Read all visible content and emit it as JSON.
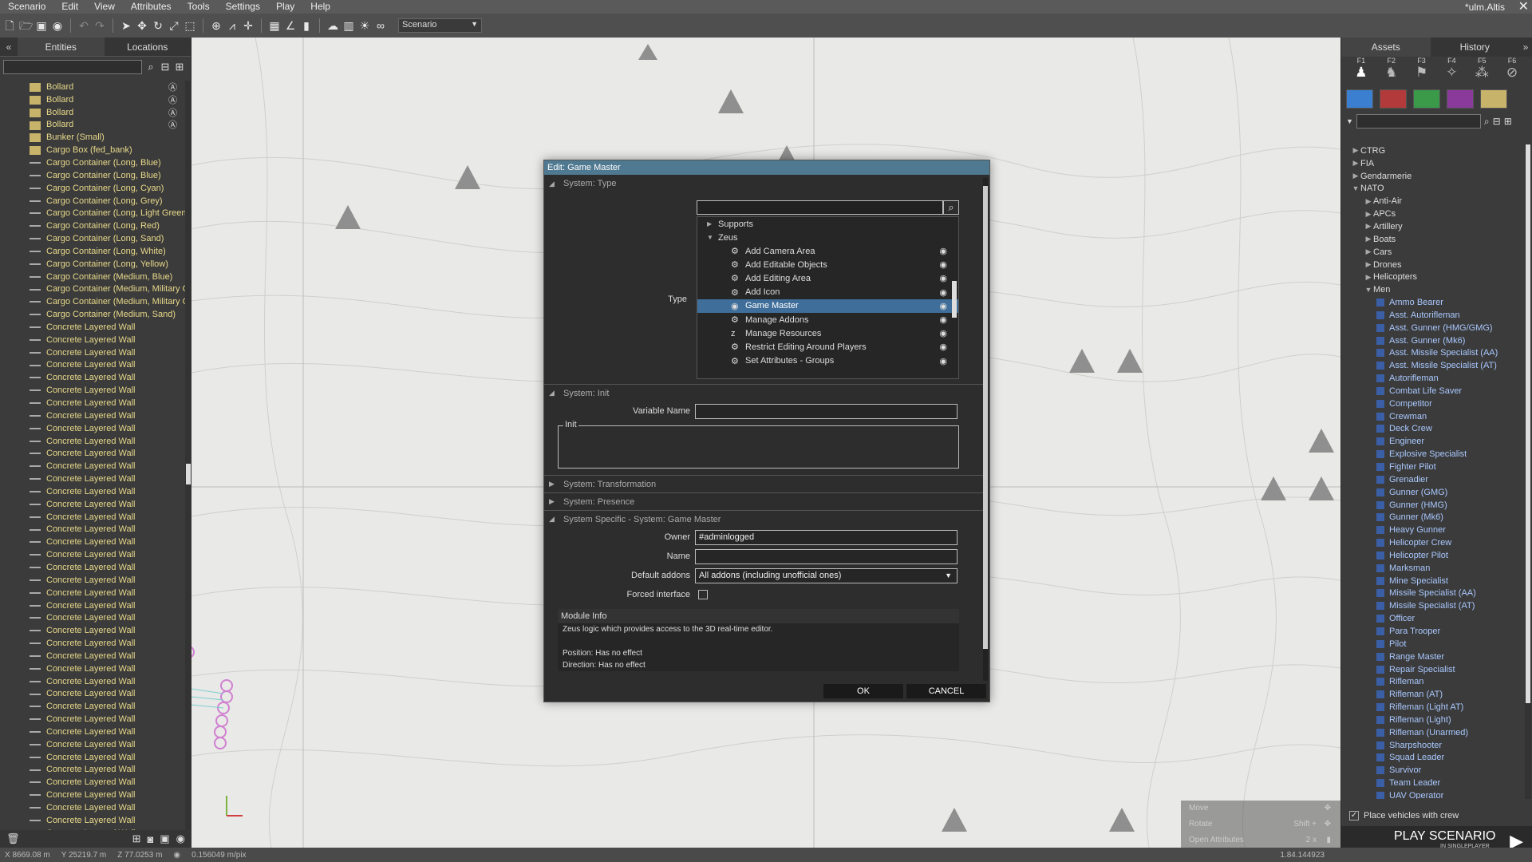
{
  "menubar": {
    "items": [
      "Scenario",
      "Edit",
      "View",
      "Attributes",
      "Tools",
      "Settings",
      "Play",
      "Help"
    ],
    "window_title": "*ulm.Altis"
  },
  "toolbar": {
    "scenario_select": "Scenario"
  },
  "left_panel": {
    "tabs": [
      "Entities",
      "Locations"
    ],
    "entities": [
      {
        "label": "Bollard",
        "icon": "box",
        "lock": true
      },
      {
        "label": "Bollard",
        "icon": "box",
        "lock": true
      },
      {
        "label": "Bollard",
        "icon": "box",
        "lock": true
      },
      {
        "label": "Bollard",
        "icon": "box",
        "lock": true
      },
      {
        "label": "Bunker (Small)",
        "icon": "box"
      },
      {
        "label": "Cargo Box (fed_bank)",
        "icon": "box"
      },
      {
        "label": "Cargo Container (Long, Blue)",
        "icon": "line"
      },
      {
        "label": "Cargo Container (Long, Blue)",
        "icon": "line"
      },
      {
        "label": "Cargo Container (Long, Cyan)",
        "icon": "line"
      },
      {
        "label": "Cargo Container (Long, Grey)",
        "icon": "line"
      },
      {
        "label": "Cargo Container (Long, Light Green)",
        "icon": "line"
      },
      {
        "label": "Cargo Container (Long, Red)",
        "icon": "line"
      },
      {
        "label": "Cargo Container (Long, Sand)",
        "icon": "line"
      },
      {
        "label": "Cargo Container (Long, White)",
        "icon": "line"
      },
      {
        "label": "Cargo Container (Long, Yellow)",
        "icon": "line"
      },
      {
        "label": "Cargo Container (Medium, Blue)",
        "icon": "line"
      },
      {
        "label": "Cargo Container (Medium, Military Gre",
        "icon": "line"
      },
      {
        "label": "Cargo Container (Medium, Military Gre",
        "icon": "line"
      },
      {
        "label": "Cargo Container (Medium, Sand)",
        "icon": "line"
      },
      {
        "label": "Concrete Layered Wall",
        "icon": "line"
      },
      {
        "label": "Concrete Layered Wall",
        "icon": "line"
      },
      {
        "label": "Concrete Layered Wall",
        "icon": "line"
      },
      {
        "label": "Concrete Layered Wall",
        "icon": "line"
      },
      {
        "label": "Concrete Layered Wall",
        "icon": "line"
      },
      {
        "label": "Concrete Layered Wall",
        "icon": "line"
      },
      {
        "label": "Concrete Layered Wall",
        "icon": "line"
      },
      {
        "label": "Concrete Layered Wall",
        "icon": "line"
      },
      {
        "label": "Concrete Layered Wall",
        "icon": "line"
      },
      {
        "label": "Concrete Layered Wall",
        "icon": "line"
      },
      {
        "label": "Concrete Layered Wall",
        "icon": "line"
      },
      {
        "label": "Concrete Layered Wall",
        "icon": "line"
      },
      {
        "label": "Concrete Layered Wall",
        "icon": "line"
      },
      {
        "label": "Concrete Layered Wall",
        "icon": "line"
      },
      {
        "label": "Concrete Layered Wall",
        "icon": "line"
      },
      {
        "label": "Concrete Layered Wall",
        "icon": "line"
      },
      {
        "label": "Concrete Layered Wall",
        "icon": "line"
      },
      {
        "label": "Concrete Layered Wall",
        "icon": "line"
      },
      {
        "label": "Concrete Layered Wall",
        "icon": "line"
      },
      {
        "label": "Concrete Layered Wall",
        "icon": "line"
      },
      {
        "label": "Concrete Layered Wall",
        "icon": "line"
      },
      {
        "label": "Concrete Layered Wall",
        "icon": "line"
      },
      {
        "label": "Concrete Layered Wall",
        "icon": "line"
      },
      {
        "label": "Concrete Layered Wall",
        "icon": "line"
      },
      {
        "label": "Concrete Layered Wall",
        "icon": "line"
      },
      {
        "label": "Concrete Layered Wall",
        "icon": "line"
      },
      {
        "label": "Concrete Layered Wall",
        "icon": "line"
      },
      {
        "label": "Concrete Layered Wall",
        "icon": "line"
      },
      {
        "label": "Concrete Layered Wall",
        "icon": "line"
      },
      {
        "label": "Concrete Layered Wall",
        "icon": "line"
      },
      {
        "label": "Concrete Layered Wall",
        "icon": "line"
      },
      {
        "label": "Concrete Layered Wall",
        "icon": "line"
      },
      {
        "label": "Concrete Layered Wall",
        "icon": "line"
      },
      {
        "label": "Concrete Layered Wall",
        "icon": "line"
      },
      {
        "label": "Concrete Layered Wall",
        "icon": "line"
      },
      {
        "label": "Concrete Layered Wall",
        "icon": "line"
      },
      {
        "label": "Concrete Layered Wall",
        "icon": "line"
      },
      {
        "label": "Concrete Layered Wall",
        "icon": "line"
      },
      {
        "label": "Concrete Layered Wall",
        "icon": "line"
      },
      {
        "label": "Concrete Layered Wall",
        "icon": "line"
      },
      {
        "label": "Concrete Layered Wall",
        "icon": "line"
      }
    ]
  },
  "right_panel": {
    "tabs": [
      "Assets",
      "History"
    ],
    "fkeys": [
      "F1",
      "F2",
      "F3",
      "F4",
      "F5",
      "F6"
    ],
    "side_colors": [
      "#3a7fd0",
      "#b33a3a",
      "#3a9a4a",
      "#8a3a9a",
      "#c8b36a"
    ],
    "tree": [
      {
        "label": "CTRG",
        "level": 0,
        "expanded": false
      },
      {
        "label": "FIA",
        "level": 0,
        "expanded": false
      },
      {
        "label": "Gendarmerie",
        "level": 0,
        "expanded": false
      },
      {
        "label": "NATO",
        "level": 0,
        "expanded": true
      },
      {
        "label": "Anti-Air",
        "level": 1,
        "expanded": false
      },
      {
        "label": "APCs",
        "level": 1,
        "expanded": false
      },
      {
        "label": "Artillery",
        "level": 1,
        "expanded": false
      },
      {
        "label": "Boats",
        "level": 1,
        "expanded": false
      },
      {
        "label": "Cars",
        "level": 1,
        "expanded": false
      },
      {
        "label": "Drones",
        "level": 1,
        "expanded": false
      },
      {
        "label": "Helicopters",
        "level": 1,
        "expanded": false
      },
      {
        "label": "Men",
        "level": 1,
        "expanded": true
      },
      {
        "label": "Ammo Bearer",
        "level": 2
      },
      {
        "label": "Asst. Autorifleman",
        "level": 2
      },
      {
        "label": "Asst. Gunner (HMG/GMG)",
        "level": 2
      },
      {
        "label": "Asst. Gunner (Mk6)",
        "level": 2
      },
      {
        "label": "Asst. Missile Specialist (AA)",
        "level": 2
      },
      {
        "label": "Asst. Missile Specialist (AT)",
        "level": 2
      },
      {
        "label": "Autorifleman",
        "level": 2
      },
      {
        "label": "Combat Life Saver",
        "level": 2
      },
      {
        "label": "Competitor",
        "level": 2
      },
      {
        "label": "Crewman",
        "level": 2
      },
      {
        "label": "Deck Crew",
        "level": 2
      },
      {
        "label": "Engineer",
        "level": 2
      },
      {
        "label": "Explosive Specialist",
        "level": 2
      },
      {
        "label": "Fighter Pilot",
        "level": 2
      },
      {
        "label": "Grenadier",
        "level": 2
      },
      {
        "label": "Gunner (GMG)",
        "level": 2
      },
      {
        "label": "Gunner (HMG)",
        "level": 2
      },
      {
        "label": "Gunner (Mk6)",
        "level": 2
      },
      {
        "label": "Heavy Gunner",
        "level": 2
      },
      {
        "label": "Helicopter Crew",
        "level": 2
      },
      {
        "label": "Helicopter Pilot",
        "level": 2
      },
      {
        "label": "Marksman",
        "level": 2
      },
      {
        "label": "Mine Specialist",
        "level": 2
      },
      {
        "label": "Missile Specialist (AA)",
        "level": 2
      },
      {
        "label": "Missile Specialist (AT)",
        "level": 2
      },
      {
        "label": "Officer",
        "level": 2
      },
      {
        "label": "Para Trooper",
        "level": 2
      },
      {
        "label": "Pilot",
        "level": 2
      },
      {
        "label": "Range Master",
        "level": 2
      },
      {
        "label": "Repair Specialist",
        "level": 2
      },
      {
        "label": "Rifleman",
        "level": 2
      },
      {
        "label": "Rifleman (AT)",
        "level": 2
      },
      {
        "label": "Rifleman (Light AT)",
        "level": 2
      },
      {
        "label": "Rifleman (Light)",
        "level": 2
      },
      {
        "label": "Rifleman (Unarmed)",
        "level": 2
      },
      {
        "label": "Sharpshooter",
        "level": 2
      },
      {
        "label": "Squad Leader",
        "level": 2
      },
      {
        "label": "Survivor",
        "level": 2
      },
      {
        "label": "Team Leader",
        "level": 2
      },
      {
        "label": "UAV Operator",
        "level": 2
      }
    ],
    "place_vehicles": "Place vehicles with crew",
    "play": {
      "title": "PLAY SCENARIO",
      "subtitle": "IN SINGLEPLAYER"
    }
  },
  "hints": [
    {
      "label": "Move",
      "key": ""
    },
    {
      "label": "Rotate",
      "key": "Shift +"
    },
    {
      "label": "Open Attributes",
      "key": "2 x"
    }
  ],
  "statusbar": {
    "x": "8669.08 m",
    "y": "25219.7 m",
    "z": "77.0253 m",
    "scale": "0.156049 m/pix",
    "zoom": "1.84.144923"
  },
  "dialog": {
    "title": "Edit: Game Master",
    "sections": {
      "type": "System: Type",
      "init": "System: Init",
      "transformation": "System: Transformation",
      "presence": "System: Presence",
      "specific": "System Specific - System: Game Master"
    },
    "type_label": "Type",
    "type_list": {
      "groups": [
        "Supports",
        "Zeus"
      ],
      "items": [
        {
          "label": "Add Camera Area",
          "icon": "gear",
          "selected": false
        },
        {
          "label": "Add Editable Objects",
          "icon": "gear",
          "selected": false
        },
        {
          "label": "Add Editing Area",
          "icon": "gear",
          "selected": false
        },
        {
          "label": "Add Icon",
          "icon": "gear",
          "selected": false
        },
        {
          "label": "Game Master",
          "icon": "eye",
          "selected": true
        },
        {
          "label": "Manage Addons",
          "icon": "gear",
          "selected": false
        },
        {
          "label": "Manage Resources",
          "icon": "z",
          "selected": false
        },
        {
          "label": "Restrict Editing Around Players",
          "icon": "gear",
          "selected": false
        },
        {
          "label": "Set Attributes - Groups",
          "icon": "gear",
          "selected": false
        }
      ]
    },
    "variable_name_label": "Variable Name",
    "variable_name_value": "",
    "init_label": "Init",
    "owner_label": "Owner",
    "owner_value": "#adminlogged",
    "name_label": "Name",
    "name_value": "",
    "default_addons_label": "Default addons",
    "default_addons_value": "All addons (including unofficial ones)",
    "forced_interface_label": "Forced interface",
    "module_info": {
      "title": "Module Info",
      "lines": [
        "Zeus logic which provides access to the 3D real-time editor.",
        "",
        "Position: Has no effect",
        "Direction: Has no effect"
      ]
    },
    "ok_label": "OK",
    "cancel_label": "CANCEL"
  }
}
